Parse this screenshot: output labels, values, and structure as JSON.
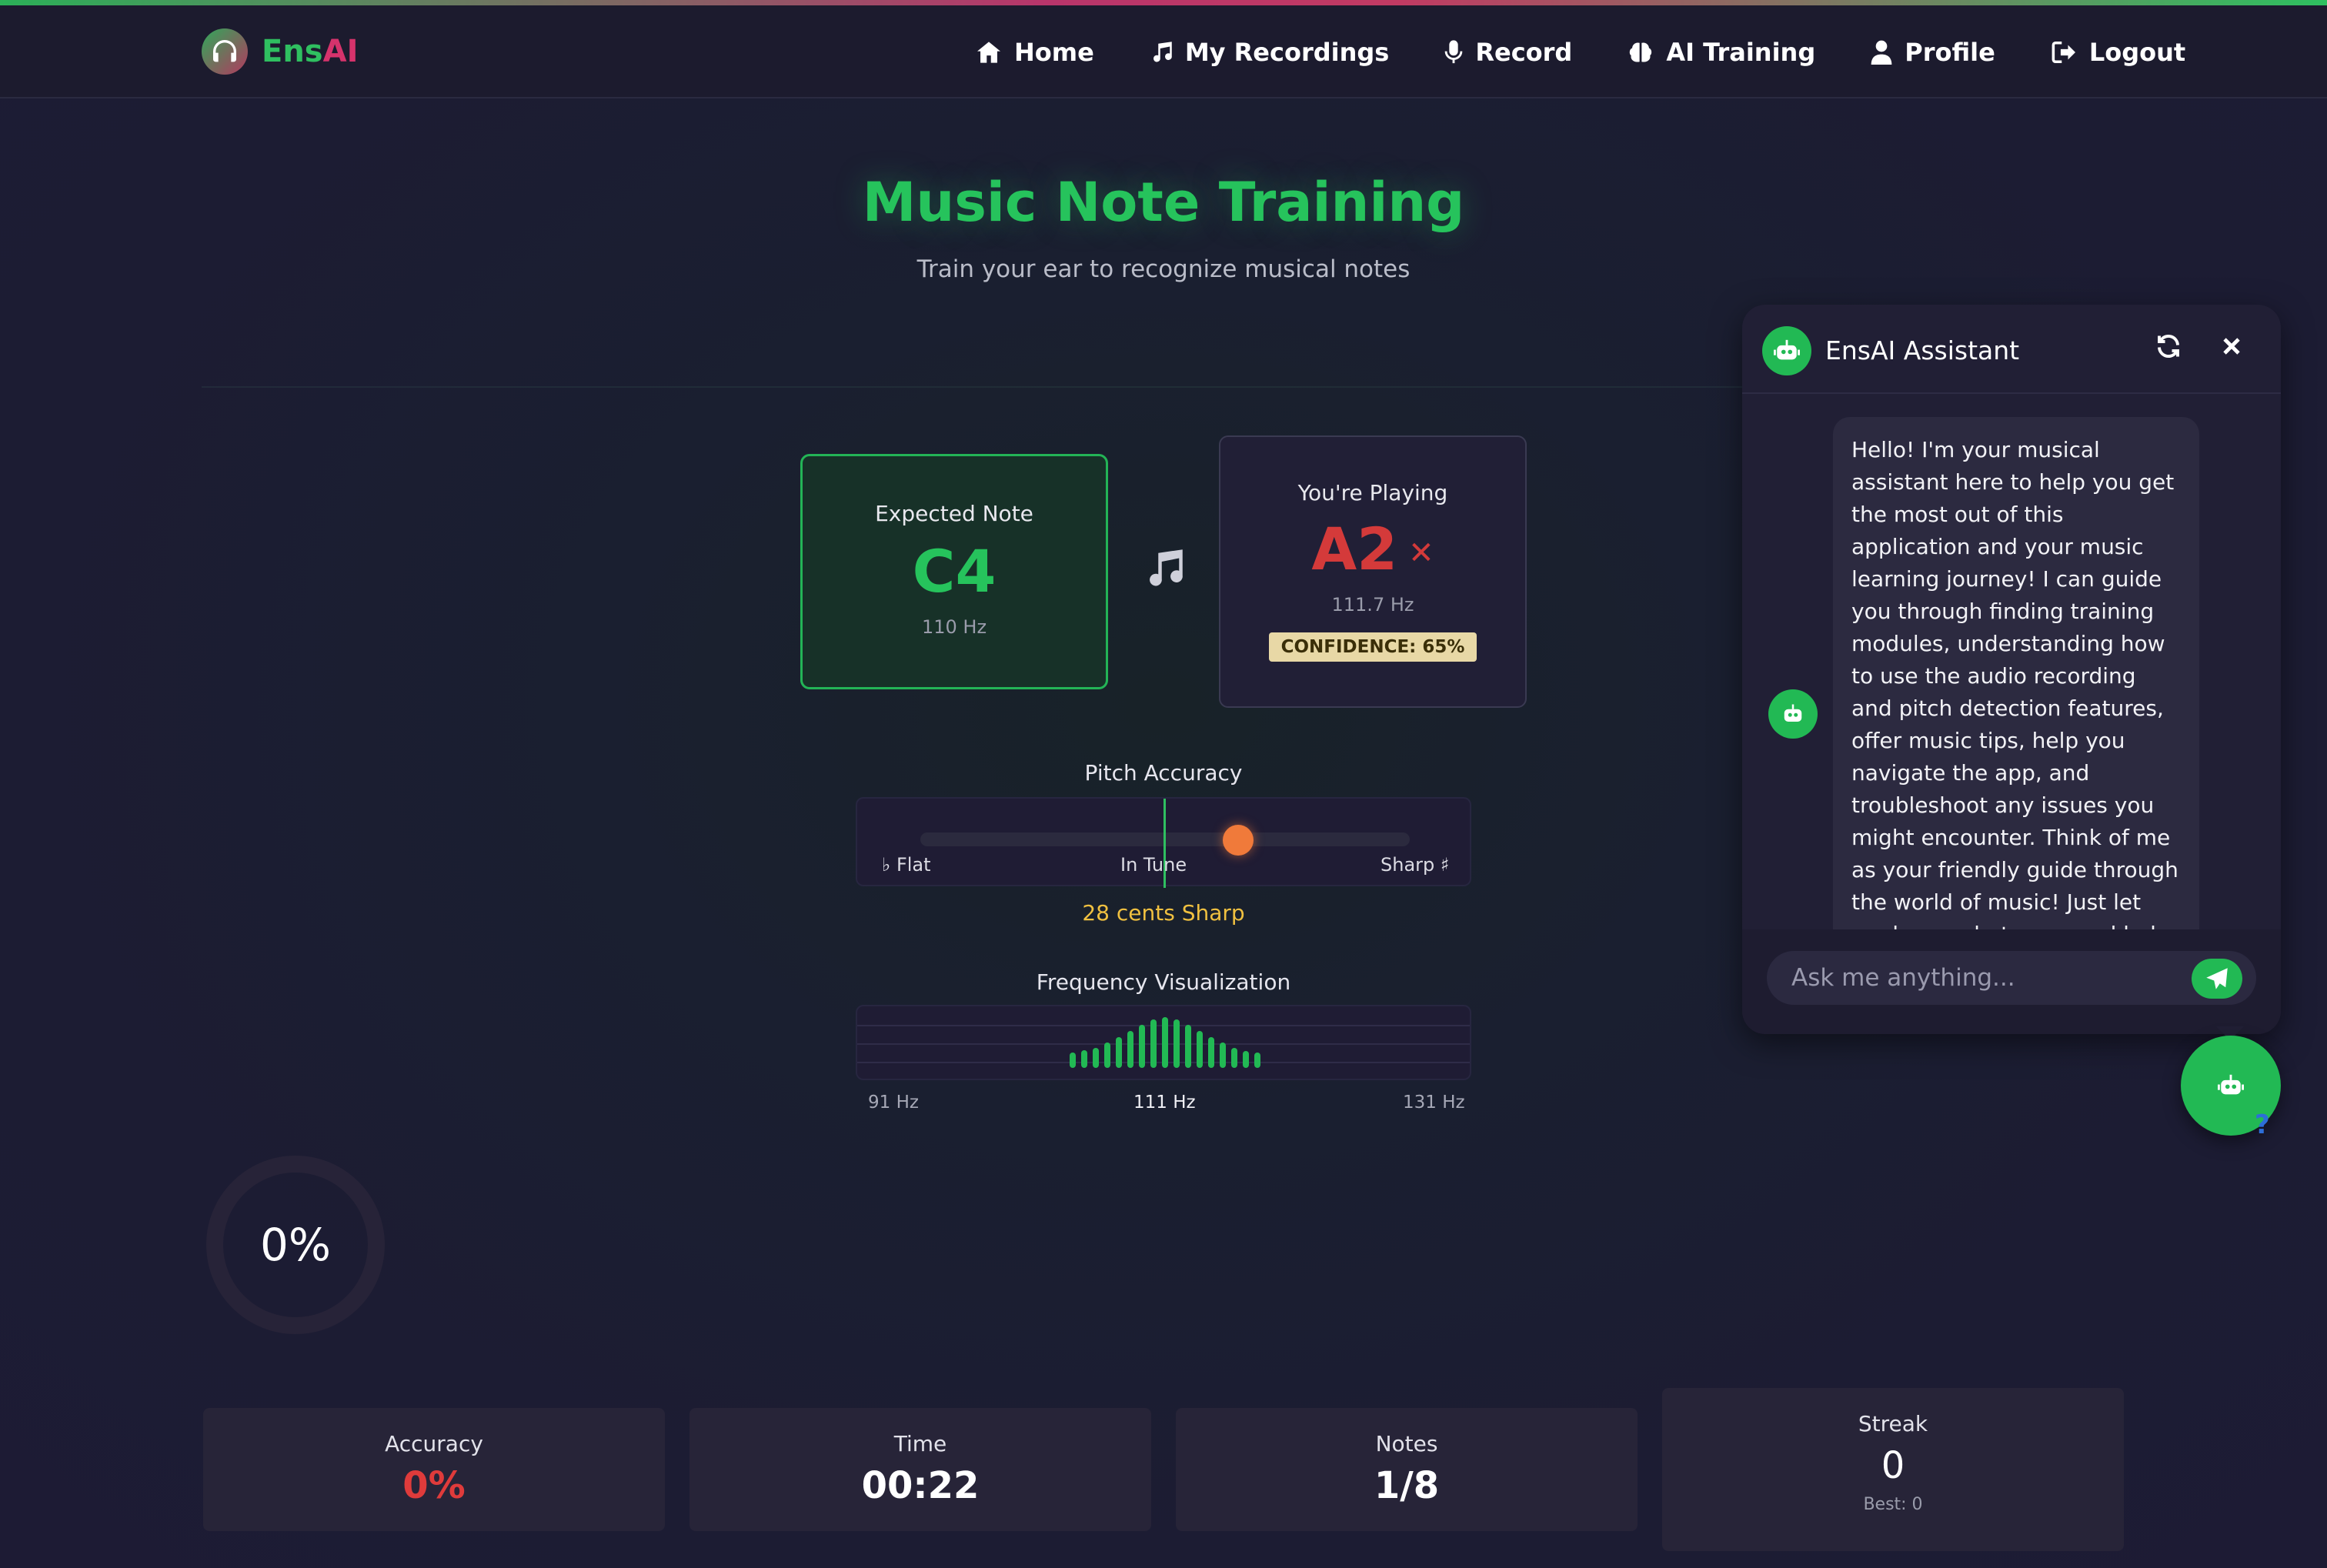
{
  "brand": {
    "name_prefix": "Ens",
    "name_suffix": "AI"
  },
  "nav": {
    "items": [
      {
        "label": "Home",
        "icon": "home-icon"
      },
      {
        "label": "My Recordings",
        "icon": "music-note-icon"
      },
      {
        "label": "Record",
        "icon": "microphone-icon"
      },
      {
        "label": "AI Training",
        "icon": "brain-icon"
      },
      {
        "label": "Profile",
        "icon": "user-icon"
      },
      {
        "label": "Logout",
        "icon": "logout-icon"
      }
    ]
  },
  "page": {
    "title": "Music Note Training",
    "subtitle": "Train your ear to recognize musical notes"
  },
  "expected": {
    "label": "Expected Note",
    "note": "C4",
    "hz": "110 Hz"
  },
  "playing": {
    "label": "You're Playing",
    "note": "A2",
    "status_icon": "x-icon",
    "hz": "111.7 Hz",
    "confidence": "CONFIDENCE: 65%"
  },
  "pitch": {
    "label": "Pitch Accuracy",
    "flat_label": "♭ Flat",
    "tune_label": "In Tune",
    "sharp_label": "Sharp ♯",
    "cents_text": "28 cents Sharp",
    "offset_fraction": 0.3
  },
  "frequency": {
    "label": "Frequency Visualization",
    "min_label": "91 Hz",
    "mid_label": "111 Hz",
    "max_label": "131 Hz",
    "bar_levels": [
      0.3,
      0.35,
      0.4,
      0.5,
      0.6,
      0.72,
      0.85,
      0.95,
      1.0,
      0.95,
      0.85,
      0.72,
      0.6,
      0.5,
      0.4,
      0.33,
      0.3
    ]
  },
  "progress": {
    "value_text": "0%",
    "value": 0
  },
  "stats": {
    "accuracy": {
      "label": "Accuracy",
      "value": "0%"
    },
    "time": {
      "label": "Time",
      "value": "00:22"
    },
    "notes": {
      "label": "Notes",
      "value": "1/8"
    },
    "streak": {
      "label": "Streak",
      "value": "0",
      "best": "Best: 0"
    }
  },
  "chat": {
    "title": "EnsAI Assistant",
    "message": "Hello! I'm your musical assistant here to help you get the most out of this application and your music learning journey! I can guide you through finding training modules, understanding how to use the audio recording and pitch detection features, offer music tips, help you navigate the app, and troubleshoot any issues you might encounter. Think of me as your friendly guide through the world of music! Just let me know what you need help with, and I'll do my best to assist you.",
    "input_placeholder": "Ask me anything...",
    "help_glyph": "?"
  },
  "colors": {
    "accent": "#22b954",
    "brand_pink": "#d6336c",
    "error": "#d43a3a",
    "warning": "#f0c040"
  }
}
